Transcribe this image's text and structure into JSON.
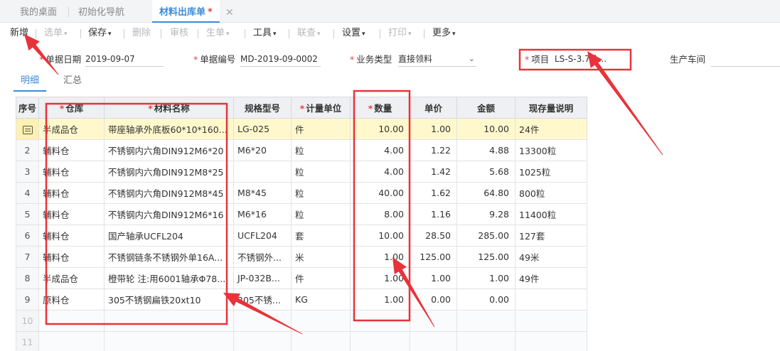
{
  "tabs": [
    {
      "label": "我的桌面"
    },
    {
      "label": "初始化导航"
    },
    {
      "label": "材料出库单",
      "modified_mark": "*",
      "close": "✕"
    }
  ],
  "toolbar": {
    "items": [
      {
        "label": "新增",
        "caret": ""
      },
      {
        "label": "选单",
        "caret": "▾"
      },
      {
        "label": "保存",
        "caret": "▾"
      },
      {
        "label": "删除",
        "caret": ""
      },
      {
        "label": "审核",
        "caret": ""
      },
      {
        "label": "生单",
        "caret": "▾"
      },
      {
        "label": "工具",
        "caret": "▾"
      },
      {
        "label": "联查",
        "caret": "▾"
      },
      {
        "label": "设置",
        "caret": "▾"
      },
      {
        "label": "打印",
        "caret": "▾"
      },
      {
        "label": "更多",
        "caret": "▾"
      }
    ]
  },
  "form": {
    "date_label": "单据日期",
    "date_value": "2019-09-07",
    "code_label": "单据编号",
    "code_value": "MD-2019-09-0002",
    "biz_type_label": "业务类型",
    "biz_type_value": "直接领料",
    "project_label": "项目",
    "project_value": "LS-S-3.7冷...",
    "workshop_label": "生产车间",
    "workshop_value": "",
    "required_mark": "*"
  },
  "subtabs": [
    "明细",
    "汇总"
  ],
  "grid": {
    "headers": [
      "序号",
      "仓库",
      "材料名称",
      "规格型号",
      "计量单位",
      "数量",
      "单价",
      "金额",
      "现存量说明"
    ],
    "rows": [
      {
        "seq": "",
        "warehouse": "半成品仓",
        "name": "带座轴承外底板60*10*160...",
        "spec": "LG-025",
        "unit": "件",
        "qty": "10.00",
        "price": "1.00",
        "amount": "10.00",
        "stock": "24件"
      },
      {
        "seq": "2",
        "warehouse": "辅料仓",
        "name": "不锈钢内六角DIN912M6*20",
        "spec": "M6*20",
        "unit": "粒",
        "qty": "4.00",
        "price": "1.22",
        "amount": "4.88",
        "stock": "13300粒"
      },
      {
        "seq": "3",
        "warehouse": "辅料仓",
        "name": "不锈钢内六角DIN912M8*25",
        "spec": "",
        "unit": "粒",
        "qty": "4.00",
        "price": "1.42",
        "amount": "5.68",
        "stock": "1025粒"
      },
      {
        "seq": "4",
        "warehouse": "辅料仓",
        "name": "不锈钢内六角DIN912M8*45",
        "spec": "M8*45",
        "unit": "粒",
        "qty": "40.00",
        "price": "1.62",
        "amount": "64.80",
        "stock": "800粒"
      },
      {
        "seq": "5",
        "warehouse": "辅料仓",
        "name": "不锈钢内六角DIN912M6*16",
        "spec": "M6*16",
        "unit": "粒",
        "qty": "8.00",
        "price": "1.16",
        "amount": "9.28",
        "stock": "11400粒"
      },
      {
        "seq": "6",
        "warehouse": "辅料仓",
        "name": "国产轴承UCFL204",
        "spec": "UCFL204",
        "unit": "套",
        "qty": "10.00",
        "price": "28.50",
        "amount": "285.00",
        "stock": "127套"
      },
      {
        "seq": "7",
        "warehouse": "辅料仓",
        "name": "不锈钢链条不锈钢外单16A...",
        "spec": "不锈钢外...",
        "unit": "米",
        "qty": "1.00",
        "price": "125.00",
        "amount": "125.00",
        "stock": "49米"
      },
      {
        "seq": "8",
        "warehouse": "半成品仓",
        "name": "橙带轮 注:用6001轴承Φ78...",
        "spec": "JP-032B...",
        "unit": "件",
        "qty": "1.00",
        "price": "1.00",
        "amount": "1.00",
        "stock": "49件"
      },
      {
        "seq": "9",
        "warehouse": "原料仓",
        "name": "305不锈钢扁铁20xt10",
        "spec": "305不锈...",
        "unit": "KG",
        "qty": "1.00",
        "price": "0.00",
        "amount": "0.00",
        "stock": ""
      },
      {
        "seq": "10",
        "warehouse": "",
        "name": "",
        "spec": "",
        "unit": "",
        "qty": "",
        "price": "",
        "amount": "",
        "stock": ""
      },
      {
        "seq": "11",
        "warehouse": "",
        "name": "",
        "spec": "",
        "unit": "",
        "qty": "",
        "price": "",
        "amount": "",
        "stock": ""
      }
    ]
  },
  "colors": {
    "accent": "#3b8bd8",
    "required": "#e04444",
    "selected_row": "#fff8cc",
    "annotation": "#e8333a"
  }
}
